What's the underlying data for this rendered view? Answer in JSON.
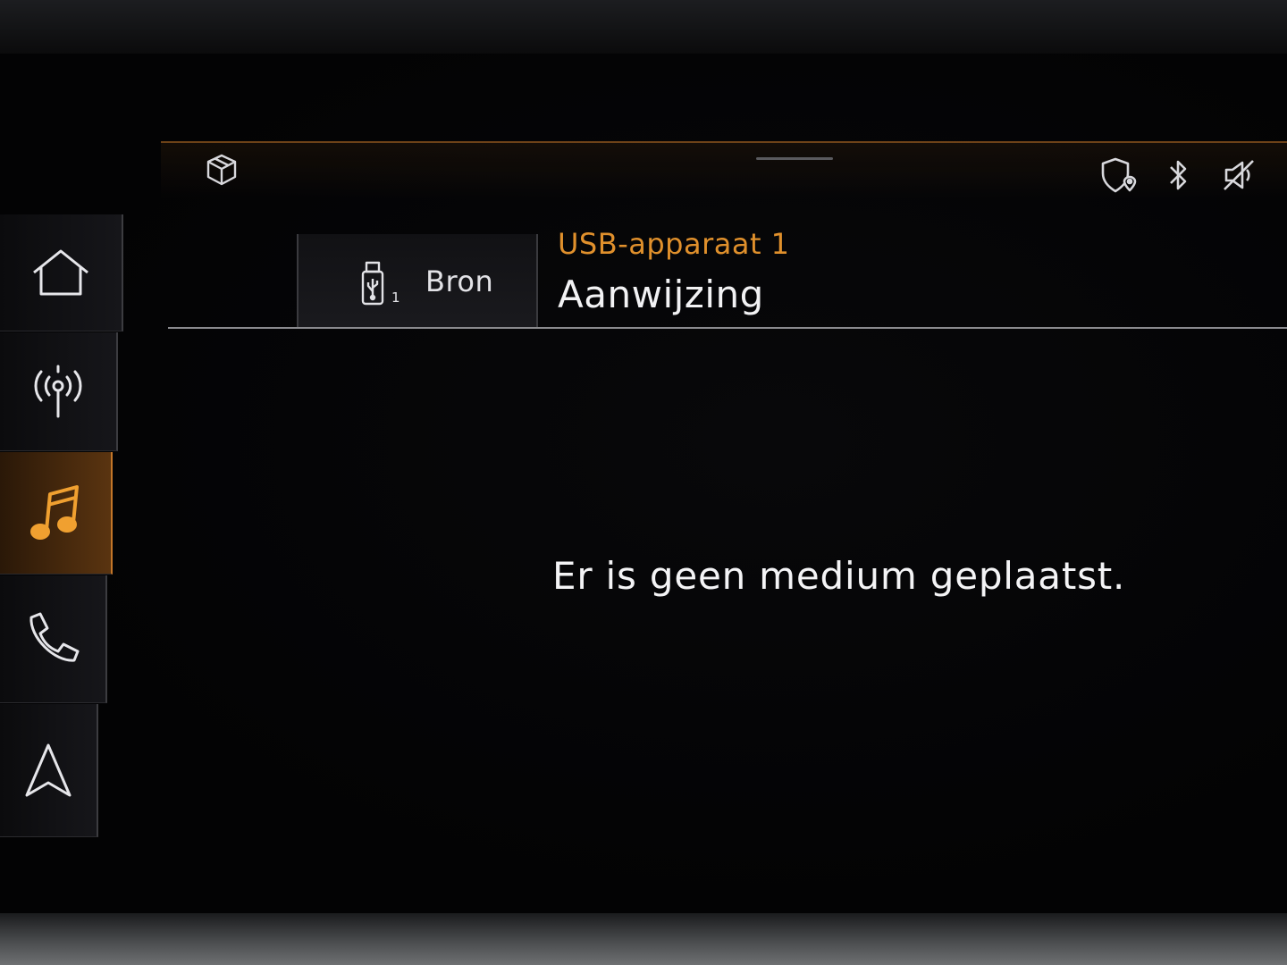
{
  "status_bar": {
    "left_icon": "cube-icon",
    "right_icons": [
      "shield-location-icon",
      "bluetooth-icon",
      "speaker-muted-icon"
    ],
    "accent_color": "#c47628"
  },
  "sidebar": {
    "items": [
      {
        "name": "home",
        "icon": "home-icon",
        "active": false
      },
      {
        "name": "radio",
        "icon": "radio-antenna-icon",
        "active": false
      },
      {
        "name": "media",
        "icon": "music-note-icon",
        "active": true
      },
      {
        "name": "phone",
        "icon": "phone-icon",
        "active": false
      },
      {
        "name": "navigation",
        "icon": "navigation-arrow-icon",
        "active": false
      }
    ]
  },
  "header": {
    "source_button_label": "Bron",
    "source_icon": "usb-stick-icon",
    "source_index": "1",
    "device_name": "USB-apparaat 1",
    "title": "Aanwijzing"
  },
  "main": {
    "message": "Er is geen medium geplaatst."
  }
}
